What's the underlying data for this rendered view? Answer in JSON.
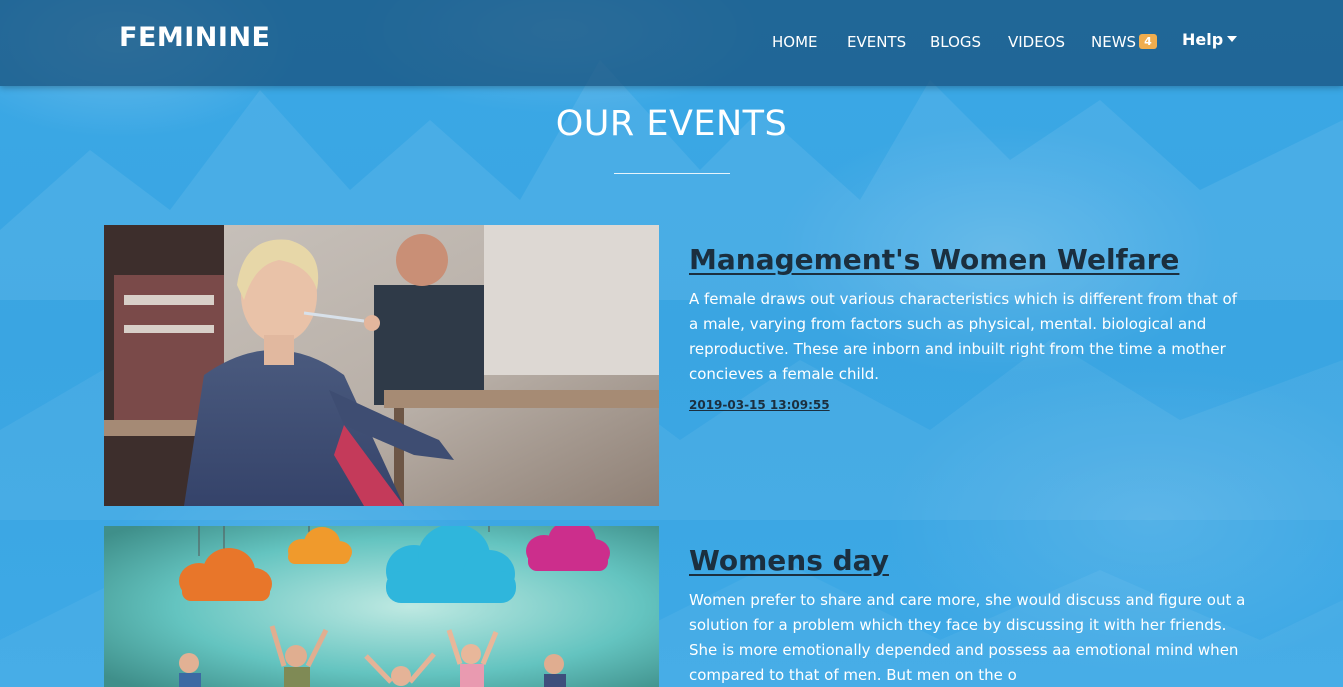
{
  "header": {
    "brand": "FEMININE",
    "nav": [
      {
        "label": "HOME"
      },
      {
        "label": "EVENTS"
      },
      {
        "label": "BLOGS"
      },
      {
        "label": "VIDEOS"
      },
      {
        "label": "NEWS",
        "badge": "4"
      }
    ],
    "help_label": "Help"
  },
  "main": {
    "section_title": "OUR EVENTS",
    "events": [
      {
        "title": "Management's Women Welfare",
        "description": "A female draws out various characteristics which is different from that of a male, varying from factors such as physical, mental. biological and reproductive. These are inborn and inbuilt right from the time a mother concieves a female child.",
        "date": "2019-03-15 13:09:55",
        "image": "classroom-photo"
      },
      {
        "title": "Womens day",
        "description": "Women prefer to share and care more, she would discuss and figure out a solution for a problem which they face by discussing it with her friends. She is more emotionally depended and possess aa emotional mind when compared to that of men. But men on the o",
        "image": "kids-clouds-photo"
      }
    ]
  },
  "colors": {
    "background": "#3aa7e4",
    "navbar": "#1d5f8e",
    "title_text": "#1b2f3f",
    "badge": "#f0ad4e"
  }
}
